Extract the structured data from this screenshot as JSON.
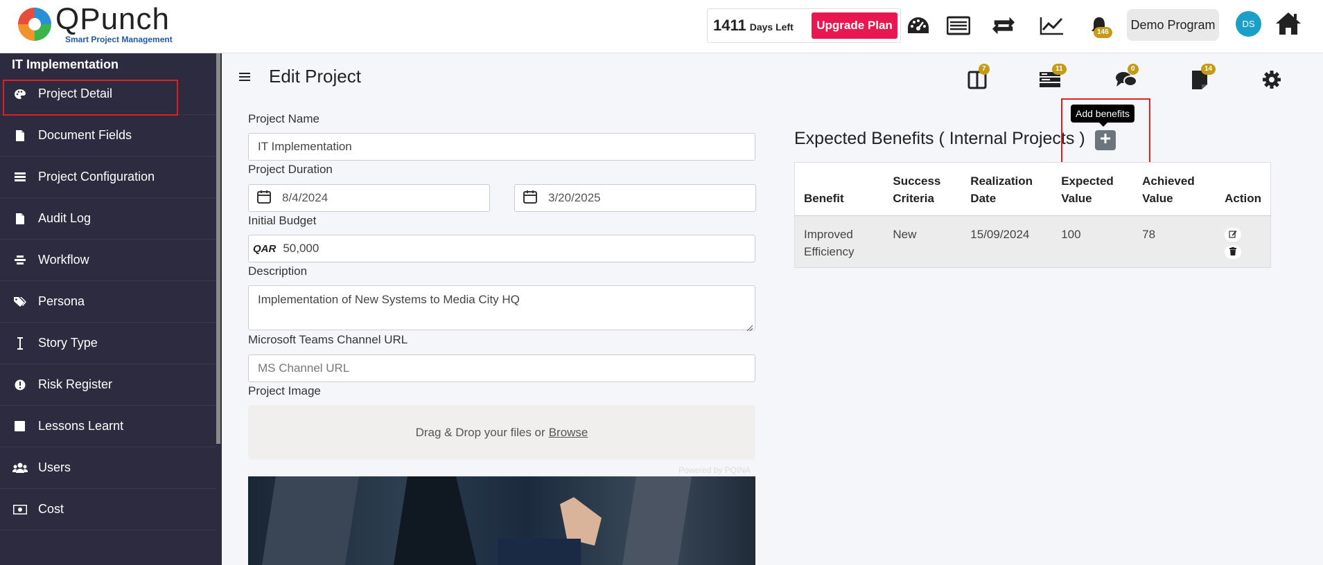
{
  "app": {
    "logo_title": "QPunch",
    "logo_subtitle": "Smart Project Management"
  },
  "header": {
    "days_left_count": "1411",
    "days_left_label": "Days Left",
    "upgrade_label": "Upgrade Plan",
    "notification_count": "146",
    "program_label": "Demo Program",
    "avatar_initials": "DS"
  },
  "sidebar": {
    "project_name": "IT Implementation",
    "items": [
      {
        "label": "Project Detail",
        "icon": "palette-icon"
      },
      {
        "label": "Document Fields",
        "icon": "document-icon"
      },
      {
        "label": "Project Configuration",
        "icon": "list-icon"
      },
      {
        "label": "Audit Log",
        "icon": "document-icon"
      },
      {
        "label": "Workflow",
        "icon": "workflow-icon"
      },
      {
        "label": "Persona",
        "icon": "tags-icon"
      },
      {
        "label": "Story Type",
        "icon": "text-cursor-icon"
      },
      {
        "label": "Risk Register",
        "icon": "exclamation-icon"
      },
      {
        "label": "Lessons Learnt",
        "icon": "square-icon"
      },
      {
        "label": "Users",
        "icon": "users-icon"
      },
      {
        "label": "Cost",
        "icon": "money-icon"
      }
    ]
  },
  "main": {
    "title": "Edit Project",
    "toolbar_badges": {
      "board": "7",
      "backlog": "11",
      "chat": "0",
      "notes": "14"
    }
  },
  "form": {
    "project_name_label": "Project Name",
    "project_name_value": "IT Implementation",
    "duration_label": "Project Duration",
    "start_date": "8/4/2024",
    "end_date": "3/20/2025",
    "budget_label": "Initial Budget",
    "currency": "QAR",
    "budget_value": "50,000",
    "description_label": "Description",
    "description_value": "Implementation of New Systems to Media City HQ",
    "teams_label": "Microsoft Teams Channel URL",
    "teams_placeholder": "MS Channel URL",
    "image_label": "Project Image",
    "dropzone_text": "Drag & Drop your files or",
    "dropzone_browse": "Browse",
    "powered_by": "Powered by PQINA"
  },
  "benefits": {
    "title": "Expected Benefits ( Internal Projects )",
    "tooltip": "Add benefits",
    "columns": [
      "Benefit",
      "Success Criteria",
      "Realization Date",
      "Expected Value",
      "Achieved Value",
      "Action"
    ],
    "rows": [
      {
        "benefit": "Improved Efficiency",
        "criteria": "New",
        "date": "15/09/2024",
        "expected": "100",
        "achieved": "78"
      }
    ]
  },
  "colors": {
    "accent_red": "#e8174f",
    "sidebar_bg": "#2d2b3f",
    "badge": "#c59a16",
    "avatar": "#1a9fc9"
  }
}
